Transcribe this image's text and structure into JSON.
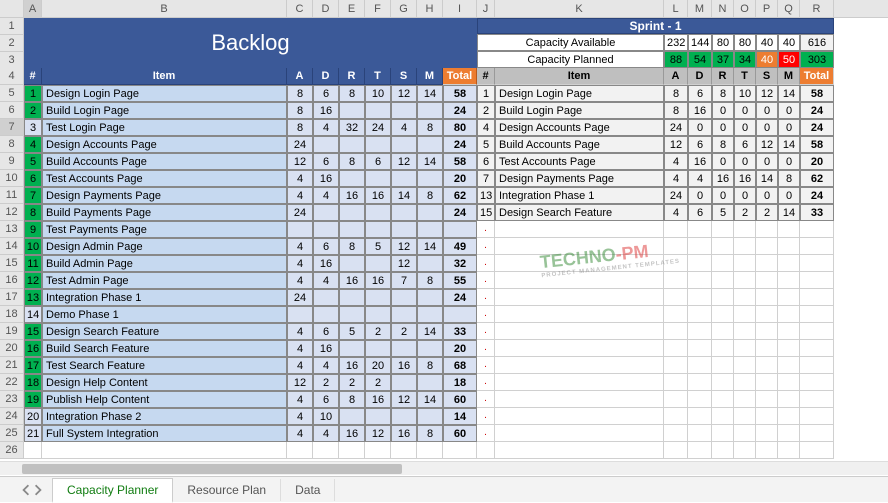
{
  "columns": [
    "A",
    "B",
    "C",
    "D",
    "E",
    "F",
    "G",
    "H",
    "I",
    "J",
    "K",
    "L",
    "M",
    "N",
    "O",
    "P",
    "Q",
    "R"
  ],
  "title_backlog": "Backlog",
  "title_sprint": "Sprint - 1",
  "cap_available_label": "Capacity Available",
  "cap_planned_label": "Capacity Planned",
  "cap_available": {
    "A": "232",
    "D": "144",
    "R": "80",
    "T": "80",
    "S": "40",
    "M": "40",
    "Total": "616"
  },
  "cap_planned": {
    "A": "88",
    "D": "54",
    "R": "37",
    "T": "34",
    "S": "40",
    "M": "50",
    "Total": "303"
  },
  "planned_classes": {
    "A": "cap-g",
    "D": "cap-g",
    "R": "cap-g",
    "T": "cap-g",
    "S": "cap-o",
    "M": "cap-r",
    "Total": "cap-pl-t"
  },
  "backlog_headers": {
    "num": "#",
    "item": "Item",
    "A": "A",
    "D": "D",
    "R": "R",
    "T": "T",
    "S": "S",
    "M": "M",
    "Total": "Total"
  },
  "sprint_headers": {
    "num": "#",
    "item": "Item",
    "A": "A",
    "D": "D",
    "R": "R",
    "T": "T",
    "S": "S",
    "M": "M",
    "Total": "Total"
  },
  "backlog": [
    {
      "n": "1",
      "item": "Design Login Page",
      "A": "8",
      "D": "6",
      "R": "8",
      "T": "10",
      "S": "12",
      "M": "14",
      "Total": "58",
      "g": true
    },
    {
      "n": "2",
      "item": "Build Login Page",
      "A": "8",
      "D": "16",
      "R": "",
      "T": "",
      "S": "",
      "M": "",
      "Total": "24",
      "g": true
    },
    {
      "n": "3",
      "item": "Test Login Page",
      "A": "8",
      "D": "4",
      "R": "32",
      "T": "24",
      "S": "4",
      "M": "8",
      "Total": "80"
    },
    {
      "n": "4",
      "item": "Design Accounts Page",
      "A": "24",
      "D": "",
      "R": "",
      "T": "",
      "S": "",
      "M": "",
      "Total": "24",
      "g": true
    },
    {
      "n": "5",
      "item": "Build Accounts Page",
      "A": "12",
      "D": "6",
      "R": "8",
      "T": "6",
      "S": "12",
      "M": "14",
      "Total": "58",
      "g": true
    },
    {
      "n": "6",
      "item": "Test Accounts Page",
      "A": "4",
      "D": "16",
      "R": "",
      "T": "",
      "S": "",
      "M": "",
      "Total": "20",
      "g": true
    },
    {
      "n": "7",
      "item": "Design Payments Page",
      "A": "4",
      "D": "4",
      "R": "16",
      "T": "16",
      "S": "14",
      "M": "8",
      "Total": "62",
      "g": true
    },
    {
      "n": "8",
      "item": "Build Payments Page",
      "A": "24",
      "D": "",
      "R": "",
      "T": "",
      "S": "",
      "M": "",
      "Total": "24",
      "g": true
    },
    {
      "n": "9",
      "item": "Test Payments Page",
      "A": "",
      "D": "",
      "R": "",
      "T": "",
      "S": "",
      "M": "",
      "Total": "",
      "g": true
    },
    {
      "n": "10",
      "item": "Design Admin Page",
      "A": "4",
      "D": "6",
      "R": "8",
      "T": "5",
      "S": "12",
      "M": "14",
      "Total": "49",
      "g": true
    },
    {
      "n": "11",
      "item": "Build Admin Page",
      "A": "4",
      "D": "16",
      "R": "",
      "T": "",
      "S": "12",
      "M": "",
      "Total": "32",
      "g": true
    },
    {
      "n": "12",
      "item": "Test Admin Page",
      "A": "4",
      "D": "4",
      "R": "16",
      "T": "16",
      "S": "7",
      "M": "8",
      "Total": "55",
      "g": true
    },
    {
      "n": "13",
      "item": "Integration Phase 1",
      "A": "24",
      "D": "",
      "R": "",
      "T": "",
      "S": "",
      "M": "",
      "Total": "24",
      "g": true
    },
    {
      "n": "14",
      "item": "Demo Phase 1",
      "A": "",
      "D": "",
      "R": "",
      "T": "",
      "S": "",
      "M": "",
      "Total": ""
    },
    {
      "n": "15",
      "item": "Design Search Feature",
      "A": "4",
      "D": "6",
      "R": "5",
      "T": "2",
      "S": "2",
      "M": "14",
      "Total": "33",
      "g": true
    },
    {
      "n": "16",
      "item": "Build Search Feature",
      "A": "4",
      "D": "16",
      "R": "",
      "T": "",
      "S": "",
      "M": "",
      "Total": "20",
      "g": true
    },
    {
      "n": "17",
      "item": "Test Search Feature",
      "A": "4",
      "D": "4",
      "R": "16",
      "T": "20",
      "S": "16",
      "M": "8",
      "Total": "68",
      "g": true
    },
    {
      "n": "18",
      "item": "Design Help Content",
      "A": "12",
      "D": "2",
      "R": "2",
      "T": "2",
      "S": "",
      "M": "",
      "Total": "18",
      "g": true
    },
    {
      "n": "19",
      "item": "Publish Help Content",
      "A": "4",
      "D": "6",
      "R": "8",
      "T": "16",
      "S": "12",
      "M": "14",
      "Total": "60",
      "g": true
    },
    {
      "n": "20",
      "item": "Integration Phase 2",
      "A": "4",
      "D": "10",
      "R": "",
      "T": "",
      "S": "",
      "M": "",
      "Total": "14"
    },
    {
      "n": "21",
      "item": "Full System Integration",
      "A": "4",
      "D": "4",
      "R": "16",
      "T": "12",
      "S": "16",
      "M": "8",
      "Total": "60"
    }
  ],
  "sprint": [
    {
      "n": "1",
      "item": "Design Login Page",
      "A": "8",
      "D": "6",
      "R": "8",
      "T": "10",
      "S": "12",
      "M": "14",
      "Total": "58"
    },
    {
      "n": "2",
      "item": "Build Login Page",
      "A": "8",
      "D": "16",
      "R": "0",
      "T": "0",
      "S": "0",
      "M": "0",
      "Total": "24"
    },
    {
      "n": "4",
      "item": "Design Accounts Page",
      "A": "24",
      "D": "0",
      "R": "0",
      "T": "0",
      "S": "0",
      "M": "0",
      "Total": "24"
    },
    {
      "n": "5",
      "item": "Build Accounts Page",
      "A": "12",
      "D": "6",
      "R": "8",
      "T": "6",
      "S": "12",
      "M": "14",
      "Total": "58"
    },
    {
      "n": "6",
      "item": "Test Accounts Page",
      "A": "4",
      "D": "16",
      "R": "0",
      "T": "0",
      "S": "0",
      "M": "0",
      "Total": "20"
    },
    {
      "n": "7",
      "item": "Design Payments Page",
      "A": "4",
      "D": "4",
      "R": "16",
      "T": "16",
      "S": "14",
      "M": "8",
      "Total": "62"
    },
    {
      "n": "13",
      "item": "Integration Phase 1",
      "A": "24",
      "D": "0",
      "R": "0",
      "T": "0",
      "S": "0",
      "M": "0",
      "Total": "24"
    },
    {
      "n": "15",
      "item": "Design Search Feature",
      "A": "4",
      "D": "6",
      "R": "5",
      "T": "2",
      "S": "2",
      "M": "14",
      "Total": "33"
    }
  ],
  "row_numbers": [
    "1",
    "2",
    "3",
    "4",
    "5",
    "6",
    "7",
    "8",
    "9",
    "10",
    "11",
    "12",
    "13",
    "14",
    "15",
    "16",
    "17",
    "18",
    "19",
    "20",
    "21",
    "22",
    "23",
    "24",
    "25",
    "26"
  ],
  "tabs": [
    "Capacity Planner",
    "Resource Plan",
    "Data"
  ],
  "watermark": {
    "t1": "TECHNO",
    "t2": "-PM",
    "sub": "PROJECT MANAGEMENT TEMPLATES"
  }
}
